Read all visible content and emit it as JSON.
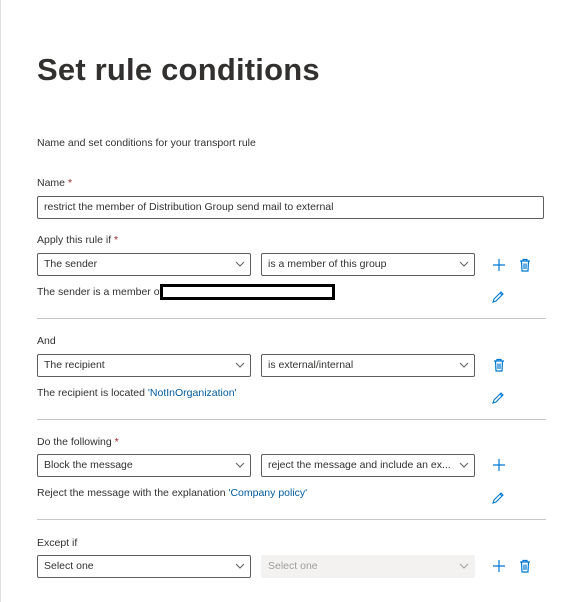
{
  "page": {
    "title": "Set rule conditions",
    "description": "Name and set conditions for your transport rule"
  },
  "name_field": {
    "label": "Name",
    "required_mark": "*",
    "value": "restrict the member of Distribution Group send mail to external"
  },
  "apply_section": {
    "label": "Apply this rule if",
    "required_mark": "*",
    "select1": "The sender",
    "select2": "is a member of this group",
    "summary_prefix": "The sender is a member of"
  },
  "and_section": {
    "label": "And",
    "select1": "The recipient",
    "select2": "is external/internal",
    "summary_prefix": "The recipient is located ",
    "summary_value": "'NotInOrganization'"
  },
  "do_section": {
    "label": "Do the following",
    "required_mark": "*",
    "select1": "Block the message",
    "select2": "reject the message and include an ex...",
    "summary_prefix": "Reject the message with the explanation ",
    "summary_value": "'Company policy'"
  },
  "except_section": {
    "label": "Except if",
    "select1": "Select one",
    "select2": "Select one"
  },
  "colors": {
    "link": "#005a9e",
    "icon": "#0078d4",
    "required": "#a4262c",
    "border": "#605e5c"
  },
  "icons": [
    "chevron-down-icon",
    "add-icon",
    "delete-icon",
    "edit-icon"
  ]
}
